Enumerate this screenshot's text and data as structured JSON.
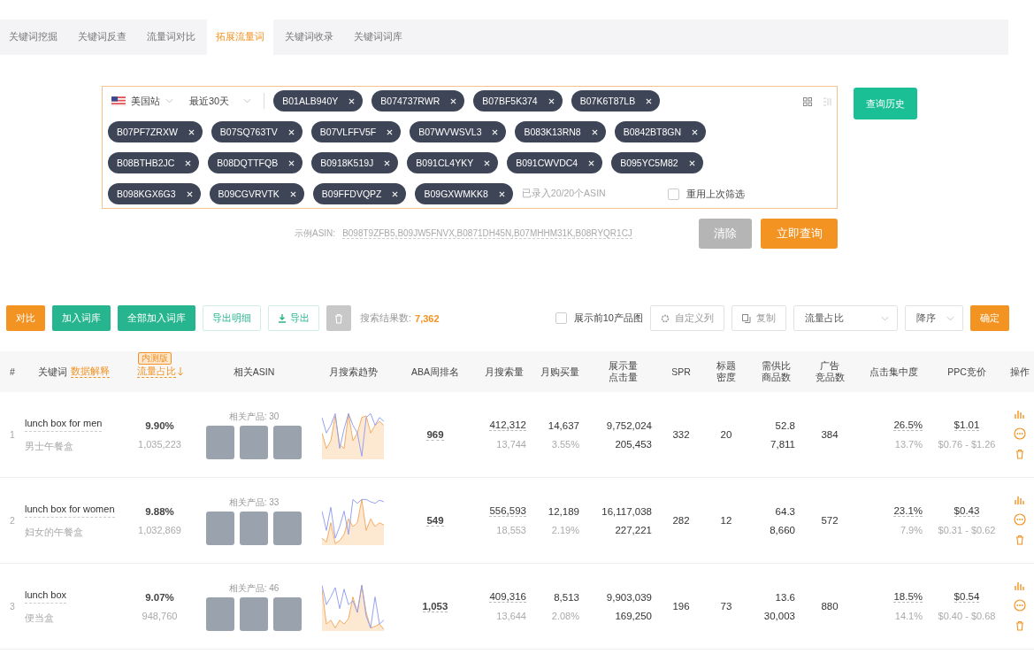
{
  "tabs": [
    {
      "label": "关键词挖掘",
      "selected": false
    },
    {
      "label": "关键词反查",
      "selected": false
    },
    {
      "label": "流量词对比",
      "selected": false
    },
    {
      "label": "拓展流量词",
      "selected": true
    },
    {
      "label": "关键词收录",
      "selected": false
    },
    {
      "label": "关键词词库",
      "selected": false
    }
  ],
  "search": {
    "site": "美国站",
    "period": "最近30天",
    "asins": [
      "B01ALB940Y",
      "B074737RWR",
      "B07BF5K374",
      "B07K6T87LB",
      "B07PF7ZRXW",
      "B07SQ763TV",
      "B07VLFFV5F",
      "B07WVWSVL3",
      "B083K13RN8",
      "B0842BT8GN",
      "B08BTHB2JC",
      "B08DQTTFQB",
      "B0918K519J",
      "B091CL4YKY",
      "B091CWVDC4",
      "B095YC5M82",
      "B098KGX6G3",
      "B09CGVRVTK",
      "B09FFDVQPZ",
      "B09GXWMKK8"
    ],
    "counter": "已录入20/20个ASIN",
    "reuse": {
      "label": "重用上次筛选",
      "checked": false
    },
    "history_button": "查询历史",
    "example_label": "示例ASIN:",
    "example_value": "B098T9ZFB5,B09JW5FNVX,B0871DH45N,B07MHHM31K,B08RYQR1CJ",
    "clear_button": "清除",
    "query_button": "立即查询"
  },
  "toolbar": {
    "buttons": [
      {
        "label": "对比",
        "kind": "orange"
      },
      {
        "label": "加入词库",
        "kind": "green"
      },
      {
        "label": "全部加入词库",
        "kind": "green"
      },
      {
        "label": "导出明细",
        "kind": "outline"
      },
      {
        "label": "导出",
        "kind": "download"
      },
      {
        "kind": "trash"
      }
    ],
    "result_label": "搜索结果数:",
    "result_count": "7,362",
    "show_images": {
      "label": "展示前10产品图",
      "checked": false
    },
    "custom_columns": "自定义列",
    "copy": "复制",
    "sort_field": "流量占比",
    "sort_order": "降序",
    "confirm": "确定"
  },
  "table": {
    "columns": [
      {
        "lines": [
          "#"
        ]
      },
      {
        "lines": [
          "关键词"
        ],
        "link": "数据解释"
      },
      {
        "lines": [
          "流量占比"
        ],
        "badge": "内测版",
        "sorted": true
      },
      {
        "lines": [
          "相关ASIN"
        ]
      },
      {
        "lines": [
          "月搜索趋势"
        ]
      },
      {
        "lines": [
          "ABA周排名"
        ]
      },
      {
        "lines": [
          "月搜索量"
        ]
      },
      {
        "lines": [
          "月购买量"
        ]
      },
      {
        "lines": [
          "展示量",
          "点击量"
        ]
      },
      {
        "lines": [
          "SPR"
        ]
      },
      {
        "lines": [
          "标题",
          "密度"
        ]
      },
      {
        "lines": [
          "需供比",
          "商品数"
        ]
      },
      {
        "lines": [
          "广告",
          "竞品数"
        ]
      },
      {
        "lines": [
          "点击集中度"
        ]
      },
      {
        "lines": [
          "PPC竞价"
        ]
      },
      {
        "lines": [
          "操作"
        ]
      }
    ],
    "rows": [
      {
        "index": "1",
        "keyword": "lunch box for men",
        "translation": "男士午餐盒",
        "share": "9.90%",
        "share_volume": "1,035,223",
        "related": "相关产品: 30",
        "aba": "969",
        "search": "412,312",
        "search_2": "13,744",
        "purchases": "14,637",
        "purchase_rate": "3.55%",
        "impressions": "9,752,024",
        "clicks": "205,453",
        "spr": "332",
        "title_density": "20",
        "supply_demand": "52.8",
        "products": "7,811",
        "ad_products": "384",
        "click_share": "26.5%",
        "click_share_2": "13.7%",
        "ppc": "$1.01",
        "ppc_range": "$0.76 - $1.26"
      },
      {
        "index": "2",
        "keyword": "lunch box for women",
        "translation": "妇女的午餐盒",
        "share": "9.88%",
        "share_volume": "1,032,869",
        "related": "相关产品: 33",
        "aba": "549",
        "search": "556,593",
        "search_2": "18,553",
        "purchases": "12,189",
        "purchase_rate": "2.19%",
        "impressions": "16,117,038",
        "clicks": "227,221",
        "spr": "282",
        "title_density": "12",
        "supply_demand": "64.3",
        "products": "8,660",
        "ad_products": "572",
        "click_share": "23.1%",
        "click_share_2": "7.9%",
        "ppc": "$0.43",
        "ppc_range": "$0.31 - $0.62"
      },
      {
        "index": "3",
        "keyword": "lunch box",
        "translation": "便当盒",
        "share": "9.07%",
        "share_volume": "948,760",
        "related": "相关产品: 46",
        "aba": "1,053",
        "search": "409,316",
        "search_2": "13,644",
        "purchases": "8,513",
        "purchase_rate": "2.08%",
        "impressions": "9,903,039",
        "clicks": "169,250",
        "spr": "196",
        "title_density": "73",
        "supply_demand": "13.6",
        "products": "30,003",
        "ad_products": "880",
        "click_share": "18.5%",
        "click_share_2": "14.1%",
        "ppc": "$0.54",
        "ppc_range": "$0.40 - $0.68"
      }
    ]
  }
}
